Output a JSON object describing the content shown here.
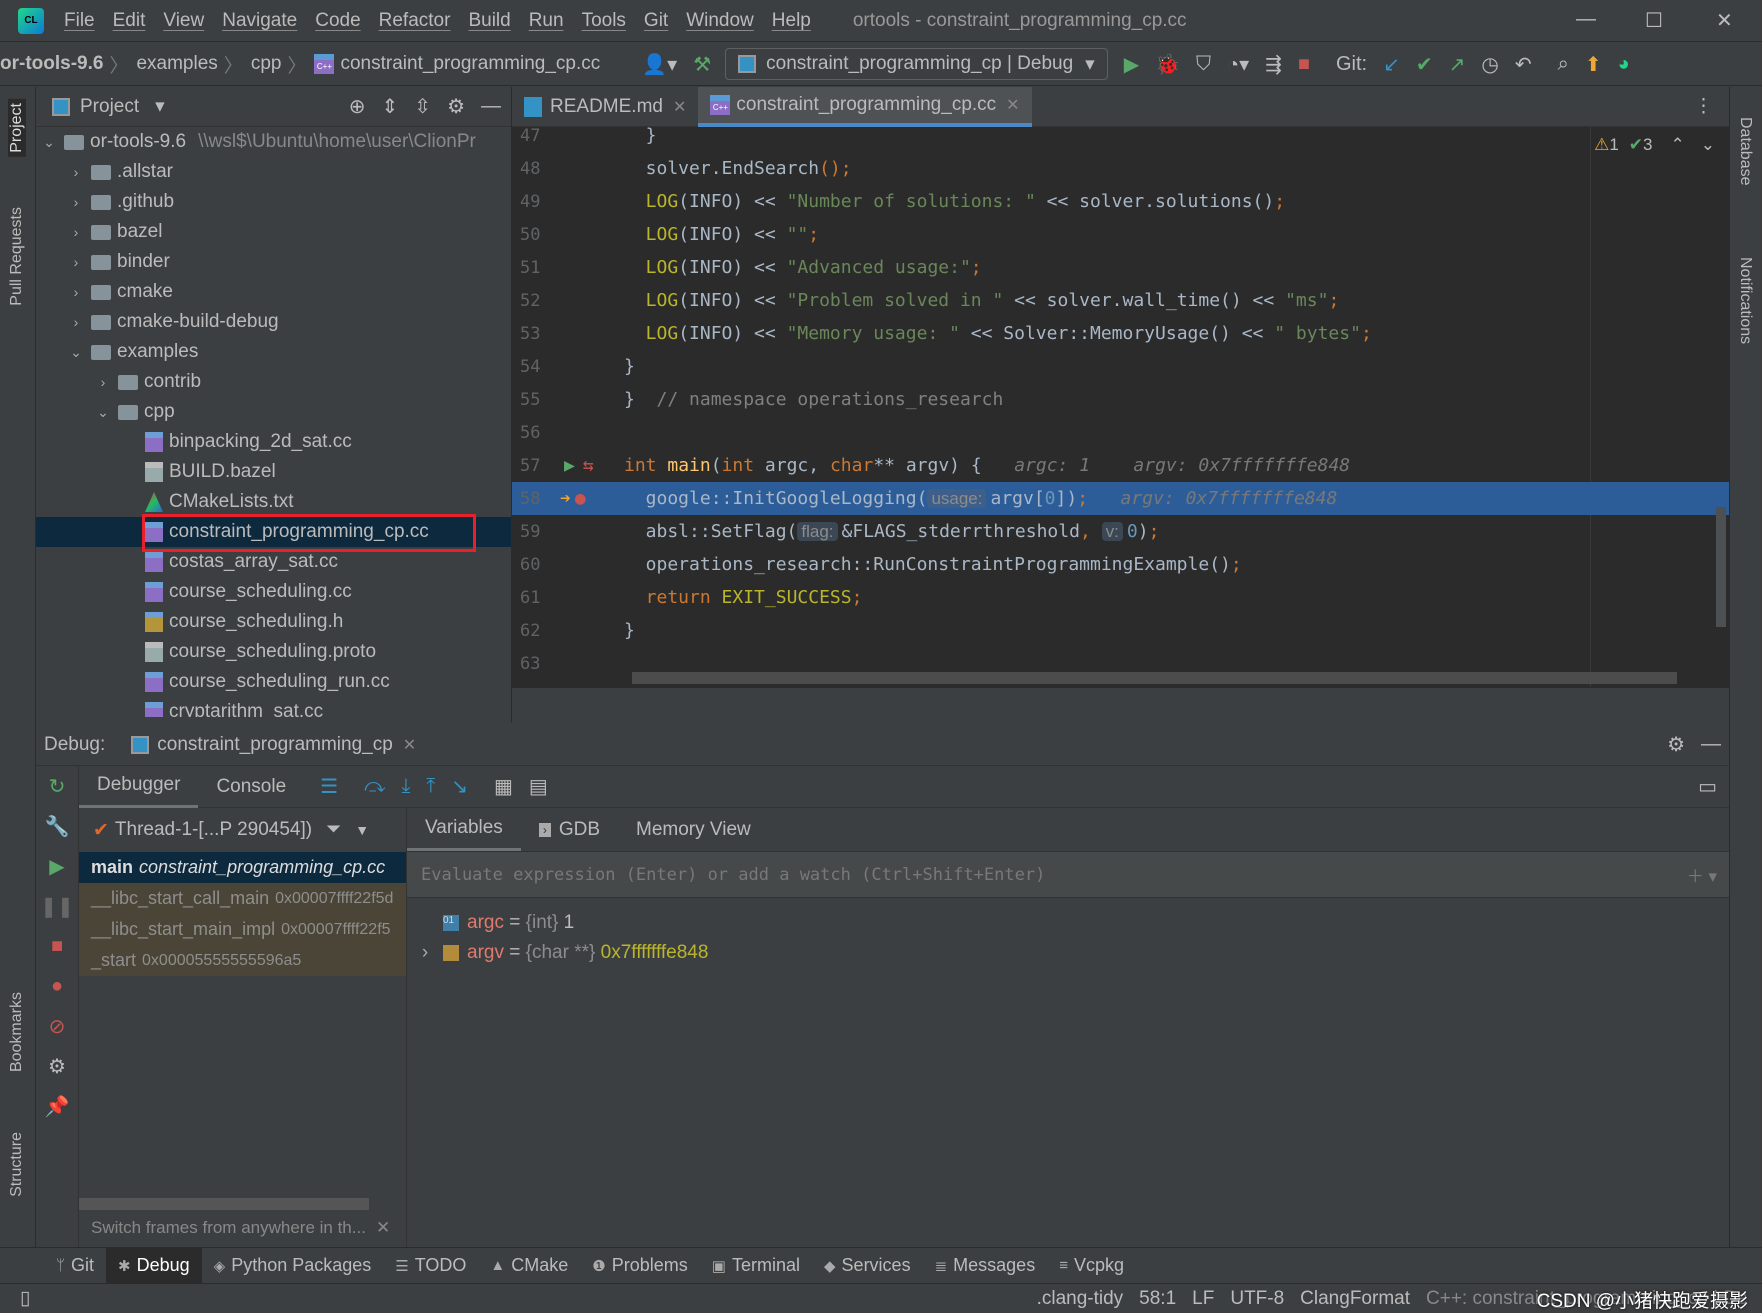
{
  "menu": [
    "File",
    "Edit",
    "View",
    "Navigate",
    "Code",
    "Refactor",
    "Build",
    "Run",
    "Tools",
    "Git",
    "Window",
    "Help"
  ],
  "window_title": "ortools - constraint_programming_cp.cc",
  "breadcrumb": [
    "or-tools-9.6",
    "examples",
    "cpp",
    "constraint_programming_cp.cc"
  ],
  "run_config": "constraint_programming_cp | Debug",
  "git_label": "Git:",
  "project": {
    "title": "Project",
    "root": {
      "name": "or-tools-9.6",
      "path": "\\\\wsl$\\Ubuntu\\home\\user\\ClionPr"
    },
    "items": [
      {
        "name": ".allstar",
        "type": "folder",
        "depth": 1,
        "open": false
      },
      {
        "name": ".github",
        "type": "folder",
        "depth": 1,
        "open": false
      },
      {
        "name": "bazel",
        "type": "folder",
        "depth": 1,
        "open": false
      },
      {
        "name": "binder",
        "type": "folder",
        "depth": 1,
        "open": false
      },
      {
        "name": "cmake",
        "type": "folder",
        "depth": 1,
        "open": false
      },
      {
        "name": "cmake-build-debug",
        "type": "folder",
        "depth": 1,
        "open": false
      },
      {
        "name": "examples",
        "type": "folder",
        "depth": 1,
        "open": true
      },
      {
        "name": "contrib",
        "type": "folder",
        "depth": 2,
        "open": false
      },
      {
        "name": "cpp",
        "type": "folder",
        "depth": 2,
        "open": true
      },
      {
        "name": "binpacking_2d_sat.cc",
        "type": "cpp",
        "depth": 3
      },
      {
        "name": "BUILD.bazel",
        "type": "txt",
        "depth": 3
      },
      {
        "name": "CMakeLists.txt",
        "type": "cmake",
        "depth": 3
      },
      {
        "name": "constraint_programming_cp.cc",
        "type": "cpp",
        "depth": 3,
        "selected": true
      },
      {
        "name": "costas_array_sat.cc",
        "type": "cpp",
        "depth": 3
      },
      {
        "name": "course_scheduling.cc",
        "type": "cpp",
        "depth": 3
      },
      {
        "name": "course_scheduling.h",
        "type": "h",
        "depth": 3
      },
      {
        "name": "course_scheduling.proto",
        "type": "txt",
        "depth": 3
      },
      {
        "name": "course_scheduling_run.cc",
        "type": "cpp",
        "depth": 3
      },
      {
        "name": "cryptarithm_sat.cc",
        "type": "cpp",
        "depth": 3
      }
    ]
  },
  "editor": {
    "tabs": [
      {
        "label": "README.md",
        "active": false
      },
      {
        "label": "constraint_programming_cp.cc",
        "active": true
      }
    ],
    "inspections": {
      "warnings": "1",
      "ok": "3"
    },
    "current_line": 58,
    "lines": [
      {
        "n": "47",
        "t": [
          [
            "  }",
            "id"
          ]
        ]
      },
      {
        "n": "48",
        "t": [
          [
            "  solver.",
            "id"
          ],
          [
            "EndSearch",
            "id"
          ],
          [
            "();",
            "kw"
          ]
        ]
      },
      {
        "n": "49",
        "t": [
          [
            "  LOG",
            "mac"
          ],
          [
            "(INFO) << ",
            "id"
          ],
          [
            "\"Number of solutions: \"",
            "str"
          ],
          [
            " << solver.solutions()",
            "id"
          ],
          [
            ";",
            "kw"
          ]
        ]
      },
      {
        "n": "50",
        "t": [
          [
            "  LOG",
            "mac"
          ],
          [
            "(INFO) << ",
            "id"
          ],
          [
            "\"\"",
            "str"
          ],
          [
            ";",
            "kw"
          ]
        ]
      },
      {
        "n": "51",
        "t": [
          [
            "  LOG",
            "mac"
          ],
          [
            "(INFO) << ",
            "id"
          ],
          [
            "\"Advanced usage:\"",
            "str"
          ],
          [
            ";",
            "kw"
          ]
        ]
      },
      {
        "n": "52",
        "t": [
          [
            "  LOG",
            "mac"
          ],
          [
            "(INFO) << ",
            "id"
          ],
          [
            "\"Problem solved in \"",
            "str"
          ],
          [
            " << solver.wall_time() << ",
            "id"
          ],
          [
            "\"ms\"",
            "str"
          ],
          [
            ";",
            "kw"
          ]
        ]
      },
      {
        "n": "53",
        "t": [
          [
            "  LOG",
            "mac"
          ],
          [
            "(INFO) << ",
            "id"
          ],
          [
            "\"Memory usage: \"",
            "str"
          ],
          [
            " << Solver::MemoryUsage() << ",
            "id"
          ],
          [
            "\" bytes\"",
            "str"
          ],
          [
            ";",
            "kw"
          ]
        ]
      },
      {
        "n": "54",
        "t": [
          [
            "}",
            "id"
          ]
        ]
      },
      {
        "n": "55",
        "t": [
          [
            "}  ",
            "id"
          ],
          [
            "// namespace operations_research",
            "cmt"
          ]
        ]
      },
      {
        "n": "56",
        "t": []
      },
      {
        "n": "57",
        "t": [
          [
            "int ",
            "kw"
          ],
          [
            "main",
            "fn"
          ],
          [
            "(",
            "id"
          ],
          [
            "int ",
            "kw"
          ],
          [
            "argc, ",
            "id"
          ],
          [
            "char",
            "kw"
          ],
          [
            "** argv) {",
            "id"
          ],
          [
            "   argc: 1    argv: 0x7fffffffe848",
            "hint"
          ]
        ]
      },
      {
        "n": "58",
        "t": [
          [
            "  google::InitGoogleLogging(",
            "id"
          ],
          [
            "usage:",
            "inlay"
          ],
          [
            "argv[",
            "id"
          ],
          [
            "0",
            "num"
          ],
          [
            "])",
            "id"
          ],
          [
            ";",
            "kw"
          ],
          [
            "   argv: 0x7fffffffe848",
            "hint"
          ]
        ]
      },
      {
        "n": "59",
        "t": [
          [
            "  absl::SetFlag(",
            "id"
          ],
          [
            "flag:",
            "inlay"
          ],
          [
            "&FLAGS_stderrthreshold",
            "id"
          ],
          [
            ", ",
            "kw"
          ],
          [
            "v:",
            "inlay"
          ],
          [
            "0",
            "num"
          ],
          [
            ")",
            "id"
          ],
          [
            ";",
            "kw"
          ]
        ]
      },
      {
        "n": "60",
        "t": [
          [
            "  operations_research::RunConstraintProgrammingExample()",
            "id"
          ],
          [
            ";",
            "kw"
          ]
        ]
      },
      {
        "n": "61",
        "t": [
          [
            "  return ",
            "kw"
          ],
          [
            "EXIT_SUCCESS",
            "mac"
          ],
          [
            ";",
            "kw"
          ]
        ]
      },
      {
        "n": "62",
        "t": [
          [
            "}",
            "id"
          ]
        ]
      },
      {
        "n": "63",
        "t": []
      }
    ]
  },
  "debug": {
    "label": "Debug:",
    "session": "constraint_programming_cp",
    "tabs": [
      "Debugger",
      "Console"
    ],
    "thread": "Thread-1-[...P 290454])",
    "frames": [
      {
        "fn": "main",
        "loc": "constraint_programming_cp.cc",
        "selected": true
      },
      {
        "fn": "__libc_start_call_main",
        "loc": "0x00007ffff22f5d"
      },
      {
        "fn": "__libc_start_main_impl",
        "loc": "0x00007ffff22f5"
      },
      {
        "fn": "_start",
        "loc": "0x00005555555596a5"
      }
    ],
    "frames_hint": "Switch frames from anywhere in th...",
    "subtabs": [
      "Variables",
      "GDB",
      "Memory View"
    ],
    "eval_placeholder": "Evaluate expression (Enter) or add a watch (Ctrl+Shift+Enter)",
    "variables": [
      {
        "name": "argc",
        "type": "{int}",
        "value": "1",
        "expandable": false
      },
      {
        "name": "argv",
        "type": "{char **}",
        "value": "0x7fffffffe848",
        "expandable": true
      }
    ]
  },
  "side_left": [
    "Project",
    "Pull Requests",
    "Bookmarks",
    "Structure"
  ],
  "side_right": [
    "Database",
    "Notifications"
  ],
  "tool_buttons": [
    {
      "label": "Git",
      "icon": "git-branch-icon"
    },
    {
      "label": "Debug",
      "icon": "bug-icon",
      "active": true
    },
    {
      "label": "Python Packages",
      "icon": "layers-icon"
    },
    {
      "label": "TODO",
      "icon": "list-icon"
    },
    {
      "label": "CMake",
      "icon": "cmake-icon"
    },
    {
      "label": "Problems",
      "icon": "warning-icon"
    },
    {
      "label": "Terminal",
      "icon": "terminal-icon"
    },
    {
      "label": "Services",
      "icon": "services-icon"
    },
    {
      "label": "Messages",
      "icon": "messages-icon"
    },
    {
      "label": "Vcpkg",
      "icon": "vcpkg-icon"
    }
  ],
  "status": {
    "lint": ".clang-tidy",
    "pos": "58:1",
    "eol": "LF",
    "enc": "UTF-8",
    "fmt": "ClangFormat",
    "ctx": "C++: constraint_programming_cp | Debug",
    "watermark": "CSDN @小猪快跑爱摄影"
  }
}
